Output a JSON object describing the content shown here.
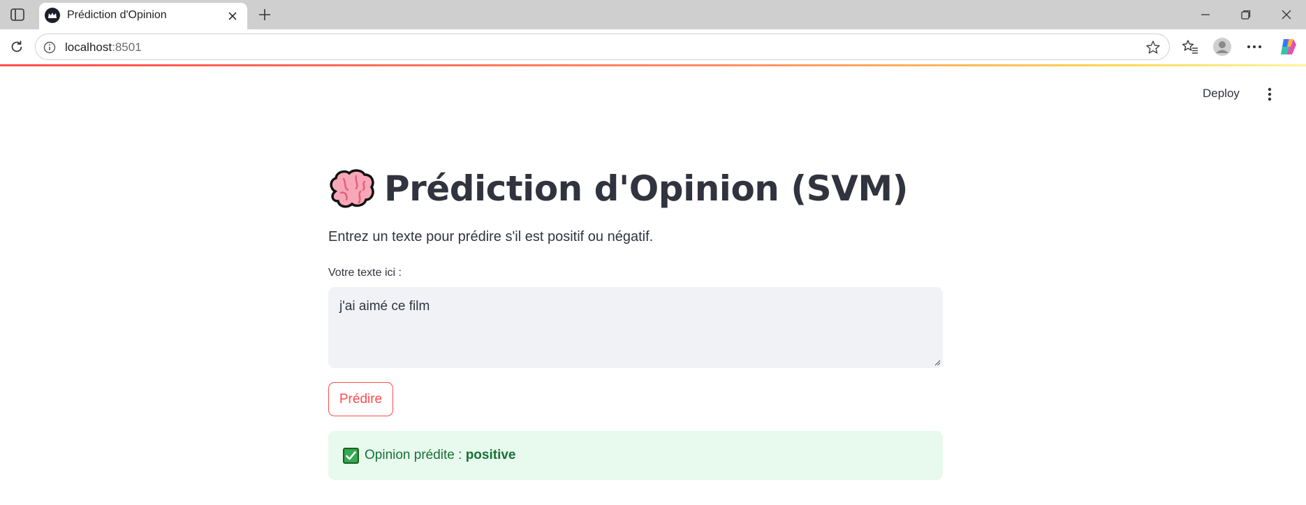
{
  "browser": {
    "tab_title": "Prédiction d'Opinion",
    "url_host": "localhost",
    "url_port": ":8501"
  },
  "app": {
    "deploy_label": "Deploy",
    "title": "Prédiction d'Opinion (SVM)",
    "title_emoji": "brain",
    "subtitle": "Entrez un texte pour prédire s'il est positif ou négatif.",
    "input_label": "Votre texte ici :",
    "input_value": "j'ai aimé ce film",
    "button_label": "Prédire",
    "result_prefix": "Opinion prédite : ",
    "result_value": "positive"
  },
  "colors": {
    "accent": "#ff4b4b",
    "success_bg": "#e8f9ee",
    "success_text": "#177233",
    "input_bg": "#f0f2f6"
  }
}
